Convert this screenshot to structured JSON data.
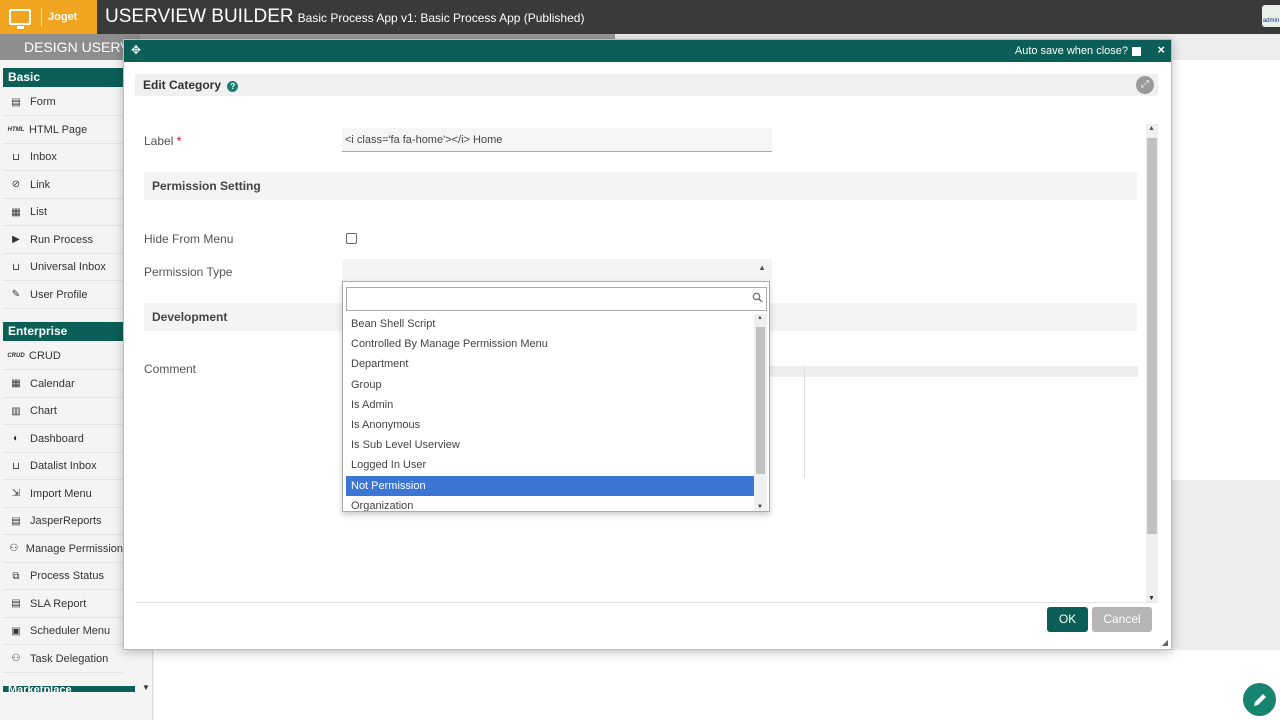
{
  "header": {
    "brand": "Joget",
    "title": "USERVIEW BUILDER",
    "subtitle": "Basic Process App v1: Basic Process App (Published)",
    "avatar_text": "admin"
  },
  "tabbar": {
    "design_tab": "DESIGN USERVIEW"
  },
  "sidebar": {
    "sections": [
      {
        "label": "Basic",
        "items": [
          {
            "label": "Form",
            "icon": "file-icon"
          },
          {
            "label": "HTML Page",
            "icon": "html-icon",
            "icon_text": "HTML"
          },
          {
            "label": "Inbox",
            "icon": "inbox-icon"
          },
          {
            "label": "Link",
            "icon": "link-icon"
          },
          {
            "label": "List",
            "icon": "table-icon"
          },
          {
            "label": "Run Process",
            "icon": "play-icon"
          },
          {
            "label": "Universal Inbox",
            "icon": "inbox-icon"
          },
          {
            "label": "User Profile",
            "icon": "user-edit-icon"
          }
        ]
      },
      {
        "label": "Enterprise",
        "items": [
          {
            "label": "CRUD",
            "icon": "crud-icon",
            "icon_text": "CRUD"
          },
          {
            "label": "Calendar",
            "icon": "calendar-icon"
          },
          {
            "label": "Chart",
            "icon": "chart-icon"
          },
          {
            "label": "Dashboard",
            "icon": "dashboard-icon"
          },
          {
            "label": "Datalist Inbox",
            "icon": "inbox-icon"
          },
          {
            "label": "Import Menu",
            "icon": "import-icon"
          },
          {
            "label": "JasperReports",
            "icon": "report-icon"
          },
          {
            "label": "Manage Permission",
            "icon": "users-lock-icon"
          },
          {
            "label": "Process Status",
            "icon": "process-status-icon"
          },
          {
            "label": "SLA Report",
            "icon": "sla-icon"
          },
          {
            "label": "Scheduler Menu",
            "icon": "scheduler-icon"
          },
          {
            "label": "Task Delegation",
            "icon": "delegation-icon"
          }
        ]
      },
      {
        "label": "Marketplace",
        "items": []
      }
    ]
  },
  "dialog": {
    "autosave_label": "Auto save when close?",
    "close_glyph": "×",
    "edit_title": "Edit Category",
    "help_glyph": "?",
    "fields": {
      "label_label": "Label",
      "required_mark": "*",
      "label_value": "<i class='fa fa-home'></i> Home",
      "permission_section": "Permission Setting",
      "hide_from_menu_label": "Hide From Menu",
      "permission_type_label": "Permission Type",
      "development_section": "Development",
      "comment_label": "Comment"
    },
    "ok_label": "OK",
    "cancel_label": "Cancel"
  },
  "dropdown": {
    "search_value": "",
    "options": [
      "Bean Shell Script",
      "Controlled By Manage Permission Menu",
      "Department",
      "Group",
      "Is Admin",
      "Is Anonymous",
      "Is Sub Level Userview",
      "Logged In User",
      "Not Permission",
      "Organization"
    ],
    "selected": "Not Permission"
  },
  "colors": {
    "brand_orange": "#f1a420",
    "header_dark": "#3a3a3a",
    "primary_green": "#0b5f56",
    "selected_blue": "#3b76d4"
  }
}
